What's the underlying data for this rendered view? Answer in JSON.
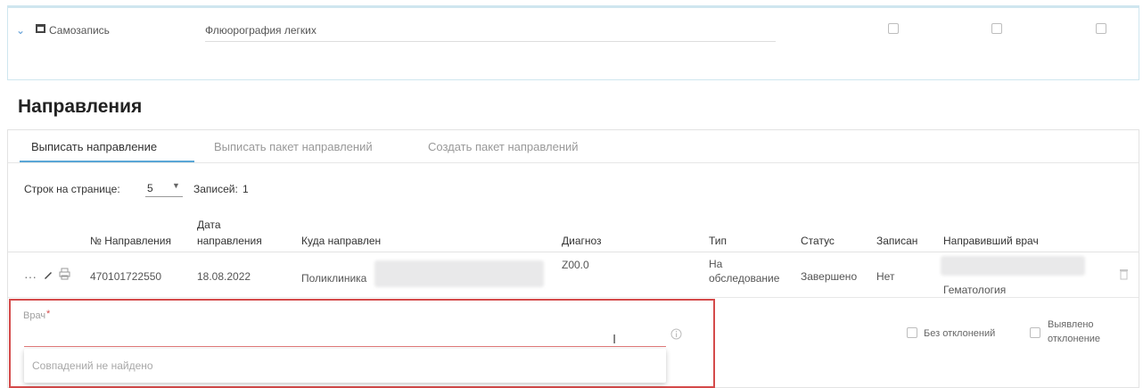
{
  "top_row": {
    "type_label": "Самозапись",
    "service_name": "Флюорография легких"
  },
  "section_title": "Направления",
  "tabs": [
    {
      "label": "Выписать направление",
      "active": true
    },
    {
      "label": "Выписать пакет направлений",
      "active": false
    },
    {
      "label": "Создать пакет направлений",
      "active": false
    }
  ],
  "pagination": {
    "rows_label": "Строк на странице:",
    "rows_value": "5",
    "records_label": "Записей:",
    "records_value": "1"
  },
  "table": {
    "headers": {
      "number": "№ Направления",
      "date_line1": "Дата",
      "date_line2": "направления",
      "destination": "Куда направлен",
      "diagnosis": "Диагноз",
      "type": "Тип",
      "status": "Статус",
      "booked": "Записан",
      "doctor": "Направивший врач"
    },
    "rows": [
      {
        "number": "470101722550",
        "date": "18.08.2022",
        "destination": "Поликлиника",
        "diagnosis": "Z00.0",
        "type_line1": "На",
        "type_line2": "обследование",
        "status": "Завершено",
        "booked": "Нет",
        "doctor_specialty": "Гематология"
      }
    ]
  },
  "doctor_field": {
    "label": "Врач",
    "required_mark": "*",
    "no_match_text": "Совпадений не найдено"
  },
  "checkboxes": {
    "no_deviation": "Без отклонений",
    "deviation_line1": "Выявлено",
    "deviation_line2": "отклонение"
  },
  "colors": {
    "accent": "#5aa6d6",
    "error": "#d44a4a",
    "panel_border": "#cfe6ef"
  }
}
